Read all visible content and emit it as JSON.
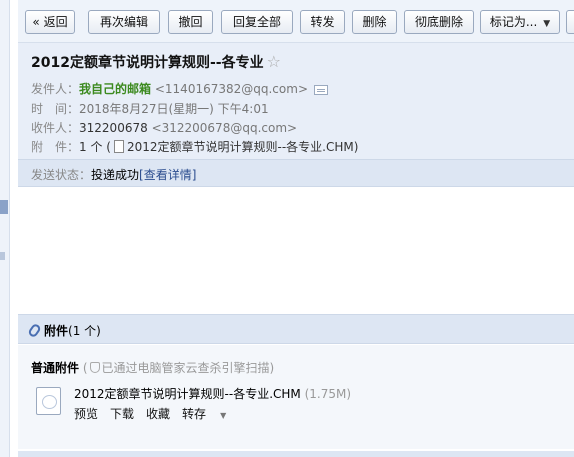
{
  "toolbar": {
    "back": "« 返回",
    "re_edit": "再次编辑",
    "recall": "撤回",
    "reply_all": "回复全部",
    "forward": "转发",
    "delete": "删除",
    "delete_permanently": "彻底删除",
    "mark_as": "标记为..."
  },
  "mail": {
    "subject": "2012定额章节说明计算规则--各专业",
    "from_label": "发件人：",
    "from_name": "我自己的邮箱",
    "from_addr": "<1140167382@qq.com>",
    "time_label": "时　间：",
    "time_value": "2018年8月27日(星期一) 下午4:01",
    "to_label": "收件人：",
    "to_name": "312200678",
    "to_addr": "<312200678@qq.com>",
    "attach_label": "附　件：",
    "attach_count": "1 个 (",
    "attach_name": "2012定额章节说明计算规则--各专业.CHM",
    "attach_close": ")"
  },
  "status": {
    "label": "发送状态：",
    "value": "投递成功",
    "detail": "[查看详情]"
  },
  "attachments": {
    "heading": "附件",
    "count": "(1 个)",
    "kind": "普通附件",
    "scan_open": "(",
    "scan_text": "已通过电脑管家云查杀引擎扫描)",
    "file_name": "2012定额章节说明计算规则--各专业.CHM",
    "file_size": "(1.75M)",
    "actions": {
      "preview": "预览",
      "download": "下载",
      "favorite": "收藏",
      "save_to": "转存"
    }
  },
  "icons": {
    "star": "star-icon",
    "contact_card": "contact-card-icon",
    "document": "document-icon",
    "paperclip": "paperclip-icon",
    "shield": "shield-icon",
    "file": "file-icon"
  },
  "colors": {
    "sender_green": "#3c8a1f",
    "header_bg": "#e8eef8",
    "bar_bg": "#dde6f3"
  }
}
